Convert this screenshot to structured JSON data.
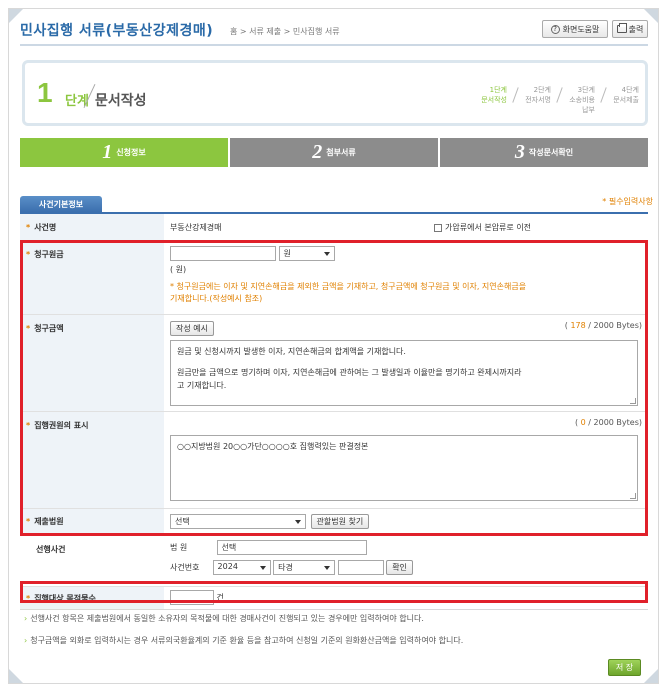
{
  "header": {
    "title": "민사집행 서류(부동산강제경매)",
    "breadcrumb": "홈 > 서류 제출 > 민사집행 서류",
    "help_label": "화면도움말",
    "print_label": "출력"
  },
  "step_box": {
    "number": "1",
    "label": "단계",
    "name": "문서작성",
    "steps": [
      {
        "num": "1단계",
        "name": "문서작성",
        "active": true
      },
      {
        "num": "2단계",
        "name": "전자서명",
        "active": false
      },
      {
        "num": "3단계",
        "name": "소송비용납부",
        "active": false
      },
      {
        "num": "4단계",
        "name": "문서제출",
        "active": false
      }
    ]
  },
  "tabs": [
    {
      "num": "1",
      "label": "신청정보",
      "active": true
    },
    {
      "num": "2",
      "label": "첨부서류",
      "active": false
    },
    {
      "num": "3",
      "label": "작성문서확인",
      "active": false
    }
  ],
  "section": {
    "title": "사건기본정보",
    "required_note": "* 필수입력사항"
  },
  "form": {
    "case_name": {
      "label": "사건명",
      "value": "부동산강제경매",
      "checkbox_label": "가압류에서 본압류로 이전"
    },
    "claim_principal": {
      "label": "청구원금",
      "currency": "원",
      "unit": "( 원)",
      "help": "* 청구원금에는 이자 및 지연손해금을 제외한 금액을 기재하고, 청구금액에 청구원금 및 이자, 지연손해금을",
      "help2": "기재합니다.(작성예시 참조)"
    },
    "claim_amount": {
      "label": "청구금액",
      "example_button": "작성 예시",
      "byte_count": "178",
      "byte_limit": "/ 2000 Bytes)",
      "text_line1": "원금 및 신청시까지 발생한 이자, 지연손해금의 합계액을 기재합니다.",
      "text_line2": "원금만을 금액으로 명기하며 이자, 지연손해금에 관하여는 그 발생일과 이율만을 명기하고 완제시까지라",
      "text_line3": "고 기재합니다."
    },
    "title_display": {
      "label": "집행권원의 표시",
      "byte_count": "0",
      "byte_limit": "/ 2000 Bytes)",
      "placeholder": "○○지방법원 20○○가단○○○○호 집행력있는 판결정본"
    },
    "court": {
      "label": "제출법원",
      "select_value": "선택",
      "find_button": "관할법원 찾기"
    },
    "prior_case": {
      "label": "선행사건",
      "court_label": "법 원",
      "court_value": "선택",
      "case_no_label": "사건번호",
      "year": "2024",
      "case_type": "타경",
      "confirm_button": "확인"
    },
    "target_count": {
      "label": "집행대상 목적물수",
      "unit": "건"
    }
  },
  "notes": [
    "선행사건 항목은 제출법원에서 동일한 소유자의 목적물에 대한 경매사건이 진행되고 있는 경우에만 입력하여야 합니다.",
    "청구금액을 외화로 입력하시는 경우 서류의국환율계의 기준 환율 등을 참고하여 신청일 기준의 원화환산금액을 입력하여야 합니다."
  ],
  "save_label": "저 장",
  "colors": {
    "accent_green": "#8cc63f",
    "brand_blue": "#2a6aa8",
    "highlight_red": "#e0202a",
    "required_orange": "#e08000"
  }
}
